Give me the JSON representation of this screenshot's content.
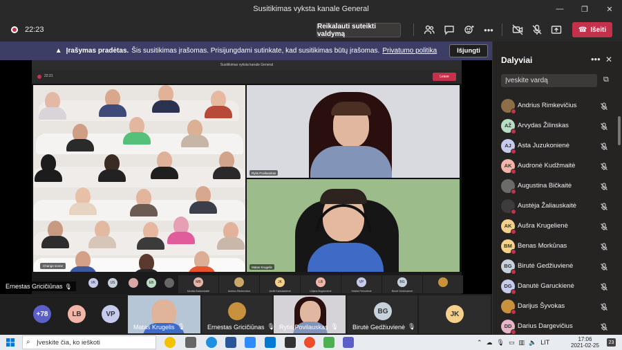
{
  "window": {
    "title": "Susitikimas vyksta kanale General",
    "controls": [
      "—",
      "❐",
      "✕"
    ]
  },
  "toolbar": {
    "timer": "22:23",
    "request_control": "Reikalauti suteikti valdymą",
    "leave": "Išeiti",
    "icons": [
      "people-icon",
      "chat-icon",
      "reactions-icon",
      "more-icon",
      "camera-off-icon",
      "mic-off-icon",
      "share-icon"
    ]
  },
  "banner": {
    "bold": "Įrašymas pradėtas.",
    "text": "Šis susitikimas įrašomas. Prisijungdami sutinkate, kad susitikimas būtų įrašomas.",
    "link": "Privatumo politika",
    "dismiss": "Išjungti"
  },
  "shared_screen": {
    "title": "Susitikimas vyksta kanale General",
    "timer": "22:21",
    "leave": "Leave",
    "change_scene": "Change scene",
    "tile1_name": "Rytis Povilauskas",
    "tile2_name": "Matas Krugelis",
    "strip": [
      {
        "initials": "MB",
        "name": "Monika Bačiumbaitė",
        "color": "#e8b4a8"
      },
      {
        "initials": "",
        "name": "Andrius Rimkevičius",
        "color": "#c9a86a"
      },
      {
        "initials": "JK",
        "name": "Jovitė Kačiušaitienė",
        "color": "#f5d08a"
      },
      {
        "initials": "LB",
        "name": "Lilijana Bogdonienė",
        "color": "#f3b5a8"
      },
      {
        "initials": "VP",
        "name": "Violeta Petronienė",
        "color": "#c6cbee"
      },
      {
        "initials": "BG",
        "name": "Birutė Gedžiuvienė",
        "color": "#c7d1dc"
      },
      {
        "initials": "",
        "name": "",
        "color": "#c8913e"
      }
    ],
    "left_avatars": [
      {
        "initials": "VK",
        "color": "#c6cbee"
      },
      {
        "initials": "US",
        "color": "#c7d1dc"
      },
      {
        "initials": "",
        "color": "#d9a7a7"
      },
      {
        "initials": "EB",
        "color": "#b9dcc5"
      },
      {
        "initials": "",
        "color": "#666666"
      }
    ]
  },
  "presenter": {
    "name": "Ernestas Gricičiūnas"
  },
  "bottom_strip": {
    "more_count": "+78",
    "avatars": [
      {
        "initials": "LB",
        "color": "#f3b5a8"
      },
      {
        "initials": "VP",
        "color": "#c6cbee"
      }
    ],
    "tiles": [
      {
        "name": "Matas Krugelis",
        "kind": "video"
      },
      {
        "name": "Ernestas Gricičiūnas",
        "kind": "photo"
      },
      {
        "name": "Rytis Povilauskas",
        "kind": "video"
      },
      {
        "name": "Birutė Gedžiuvienė",
        "kind": "avatar",
        "initials": "BG",
        "color": "#c7d1dc"
      },
      {
        "name": "",
        "kind": "avatar",
        "initials": "JK",
        "color": "#f5d08a"
      }
    ]
  },
  "participants": {
    "title": "Dalyviai",
    "search_placeholder": "Įveskite vardą",
    "list": [
      {
        "name": "Andrius Rimkevičius",
        "initials": "",
        "color": "#8c6f46",
        "photo": true
      },
      {
        "name": "Arvydas Žilinskas",
        "initials": "AŽ",
        "color": "#b9dcc5",
        "photo": false
      },
      {
        "name": "Asta Juzukonienė",
        "initials": "AJ",
        "color": "#c6cbee",
        "photo": false
      },
      {
        "name": "Audronė Kudžmaitė",
        "initials": "AK",
        "color": "#f3b5a8",
        "photo": false
      },
      {
        "name": "Augustina Bičkaitė",
        "initials": "",
        "color": "#6b6b6b",
        "photo": true
      },
      {
        "name": "Austėja Žaliauskaitė",
        "initials": "",
        "color": "#3c3c3c",
        "photo": true
      },
      {
        "name": "Aušra Krugelienė",
        "initials": "AK",
        "color": "#f5d08a",
        "photo": false
      },
      {
        "name": "Benas Morkūnas",
        "initials": "BM",
        "color": "#f5d08a",
        "photo": false
      },
      {
        "name": "Birutė Gedžiuvienė",
        "initials": "BG",
        "color": "#c7d1dc",
        "photo": false
      },
      {
        "name": "Danutė Garuckienė",
        "initials": "DG",
        "color": "#c6cbee",
        "photo": false
      },
      {
        "name": "Darijus Šyvokas",
        "initials": "",
        "color": "#c8913e",
        "photo": true
      },
      {
        "name": "Darius Dargevičius",
        "initials": "DD",
        "color": "#e8b4c8",
        "photo": false
      }
    ]
  },
  "taskbar": {
    "search_placeholder": "Įveskite čia, ko ieškoti",
    "language": "LIT",
    "time": "17:06",
    "date": "2021-02-25",
    "notifications": "23"
  }
}
